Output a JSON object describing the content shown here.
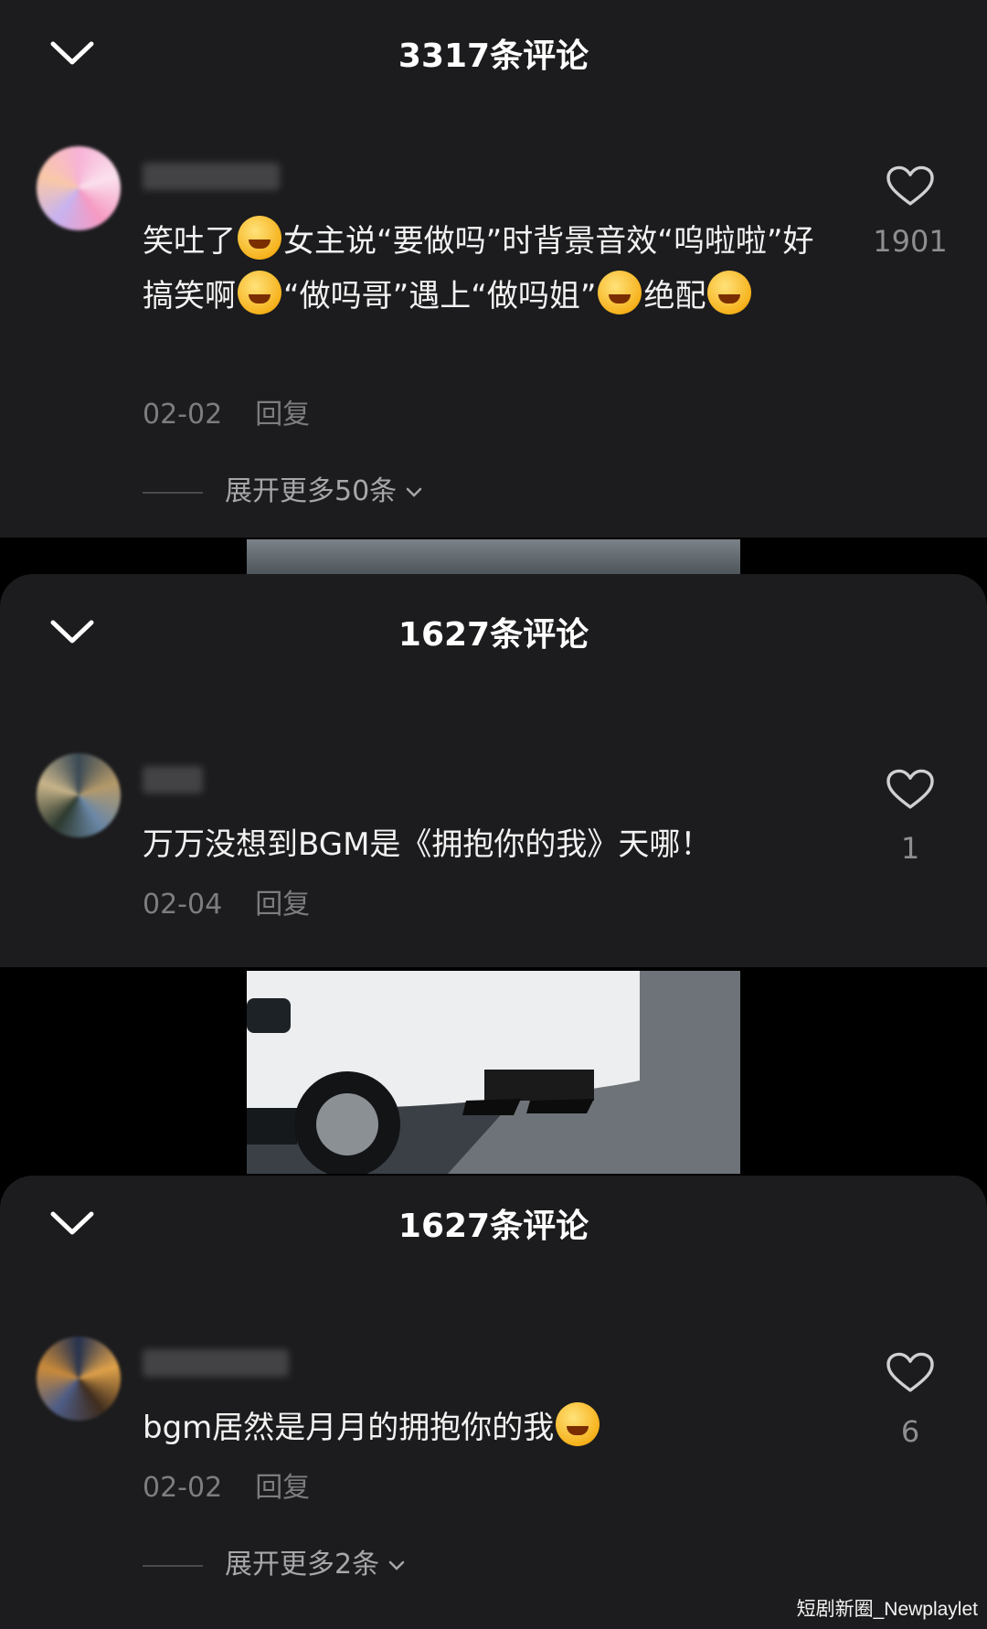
{
  "panels": [
    {
      "title": "3317条评论",
      "comment": {
        "text_parts": [
          "笑吐了",
          "女主说“要做吗”时背景音效“呜啦啦”好搞笑啊",
          "“做吗哥”遇上“做吗姐”",
          "绝配"
        ],
        "date": "02-02",
        "reply_label": "回复",
        "likes": "1901"
      },
      "expand_label": "展开更多50条"
    },
    {
      "title": "1627条评论",
      "comment": {
        "text": "万万没想到BGM是《拥抱你的我》天哪！",
        "date": "02-04",
        "reply_label": "回复",
        "likes": "1"
      }
    },
    {
      "title": "1627条评论",
      "comment": {
        "text": "bgm居然是月月的拥抱你的我",
        "date": "02-02",
        "reply_label": "回复",
        "likes": "6"
      },
      "expand_label": "展开更多2条"
    }
  ],
  "watermark": "短剧新圈_Newplaylet",
  "icons": {
    "collapse": "chevron-down-icon",
    "like": "heart-outline-icon",
    "expand": "chevron-down-small-icon",
    "emoji": "laughing-emoji-icon"
  },
  "colors": {
    "sheet_bg": "#1c1c1e",
    "page_bg": "#000000",
    "muted_text": "#7d7d80"
  }
}
